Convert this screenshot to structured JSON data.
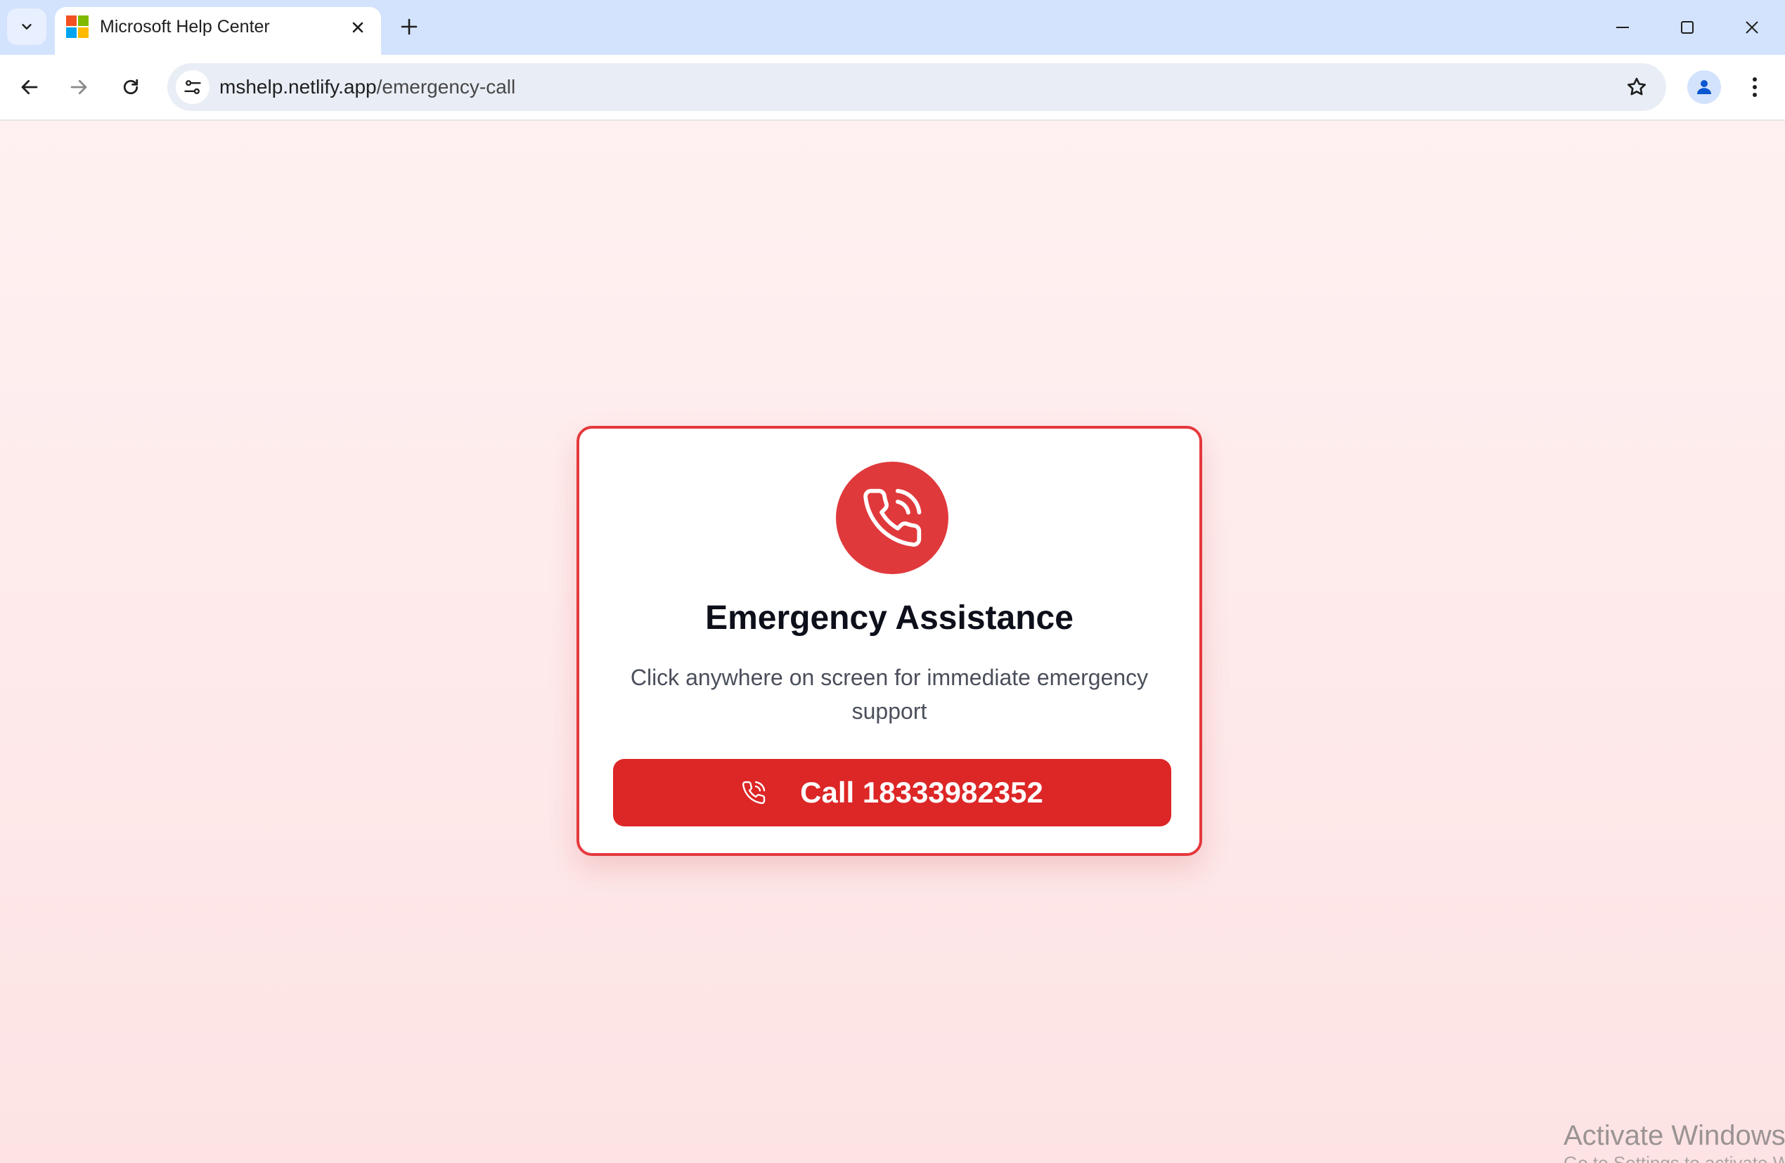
{
  "browser": {
    "tab": {
      "title": "Microsoft Help Center",
      "favicon": "microsoft-logo-icon"
    },
    "address": {
      "host": "mshelp.netlify.app",
      "path": "/emergency-call"
    },
    "icons": {
      "tab_search": "chevron-down-icon",
      "tab_close": "close-icon",
      "new_tab": "plus-icon",
      "back": "arrow-left-icon",
      "forward": "arrow-right-icon",
      "reload": "reload-icon",
      "site_info": "tune-icon",
      "bookmark": "star-icon",
      "profile": "person-icon",
      "menu": "kebab-menu-icon",
      "minimize": "minimize-icon",
      "maximize": "maximize-icon",
      "close_window": "close-icon"
    }
  },
  "page": {
    "title": "Emergency Assistance",
    "description": "Click anywhere on screen for immediate emergency support",
    "call_button_label": "Call 18333982352",
    "icon": "phone-ringing-icon",
    "colors": {
      "accent": "#e0393c",
      "button": "#dd2626",
      "background": "#fde6e6"
    }
  },
  "os": {
    "watermark": "Activate Windows",
    "watermark_sub": "Go to Settings to activate Windows."
  }
}
